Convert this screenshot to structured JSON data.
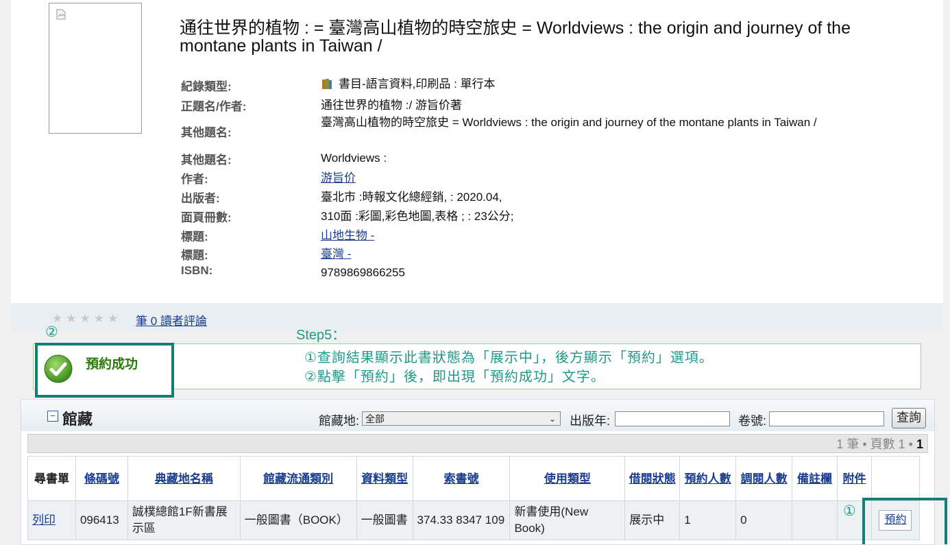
{
  "record": {
    "title": "通往世界的植物 : = 臺灣高山植物的時空旅史 = Worldviews : the origin and journey of the montane plants in Taiwan /",
    "fields": [
      {
        "label": "紀錄類型:",
        "value": "書目-語言資料,印刷品 : 單行本",
        "type": "icon-text"
      },
      {
        "label": "正題名/作者:",
        "value": "通往世界的植物 :/ 游旨价著",
        "type": "text"
      },
      {
        "label": "其他題名:",
        "value": "臺灣高山植物的時空旅史 = Worldviews : the origin and journey of the montane plants in Taiwan /",
        "type": "text"
      },
      {
        "label": "其他題名:",
        "value": "Worldviews :",
        "type": "text"
      },
      {
        "label": "作者:",
        "value": "游旨价",
        "type": "link"
      },
      {
        "label": "出版者:",
        "value": "臺北市 :時報文化總經銷, : 2020.04,",
        "type": "text"
      },
      {
        "label": "面頁冊數:",
        "value": "310面 :彩圖,彩色地圖,表格 ; : 23公分;",
        "type": "text"
      },
      {
        "label": "標題:",
        "value": "山地生物 -",
        "type": "link"
      },
      {
        "label": "標題:",
        "value": "臺灣 -",
        "type": "link"
      },
      {
        "label": "ISBN:",
        "value": "9789869866255",
        "type": "text"
      }
    ]
  },
  "reviews": {
    "stars": "★★★★★",
    "link": "筆 0 讀者評論"
  },
  "annotation": {
    "circle2": "②",
    "step_title": "Step5：",
    "step_line1": "①查詢結果顯示此書狀態為「展示中」，後方顯示「預約」選項。",
    "step_line2": "②點擊「預約」後，即出現「預約成功」文字。",
    "success": "預約成功",
    "circle1": "①"
  },
  "holdings": {
    "title": "館藏",
    "location_label": "館藏地:",
    "location_value": "全部",
    "year_label": "出版年:",
    "volume_label": "卷號:",
    "query_btn": "查詢",
    "pager_prefix": "1 筆 • 頁數 1 •",
    "pager_current": "1",
    "headers": [
      {
        "text": "尋書單",
        "link": false
      },
      {
        "text": "條碼號",
        "link": true
      },
      {
        "text": "典藏地名稱",
        "link": true
      },
      {
        "text": "館藏流通類別",
        "link": true
      },
      {
        "text": "資料類型",
        "link": true
      },
      {
        "text": "索書號",
        "link": true
      },
      {
        "text": "使用類型",
        "link": true
      },
      {
        "text": "借閱狀態",
        "link": true
      },
      {
        "text": "預約人數",
        "link": true
      },
      {
        "text": "調閱人數",
        "link": true
      },
      {
        "text": "備註欄",
        "link": true
      },
      {
        "text": "附件",
        "link": true
      },
      {
        "text": "",
        "link": false
      }
    ],
    "row": {
      "print": "列印",
      "barcode": "096413",
      "location": "誠樸總館1F新書展示區",
      "circ_type": "一般圖書（BOOK）",
      "data_type": "一般圖書",
      "call_no": "374.33 8347 109",
      "use_type": "新書使用(New Book)",
      "status": "展示中",
      "reservations": "1",
      "requests": "0",
      "note": "",
      "attachment": "",
      "reserve_btn": "預約"
    }
  }
}
